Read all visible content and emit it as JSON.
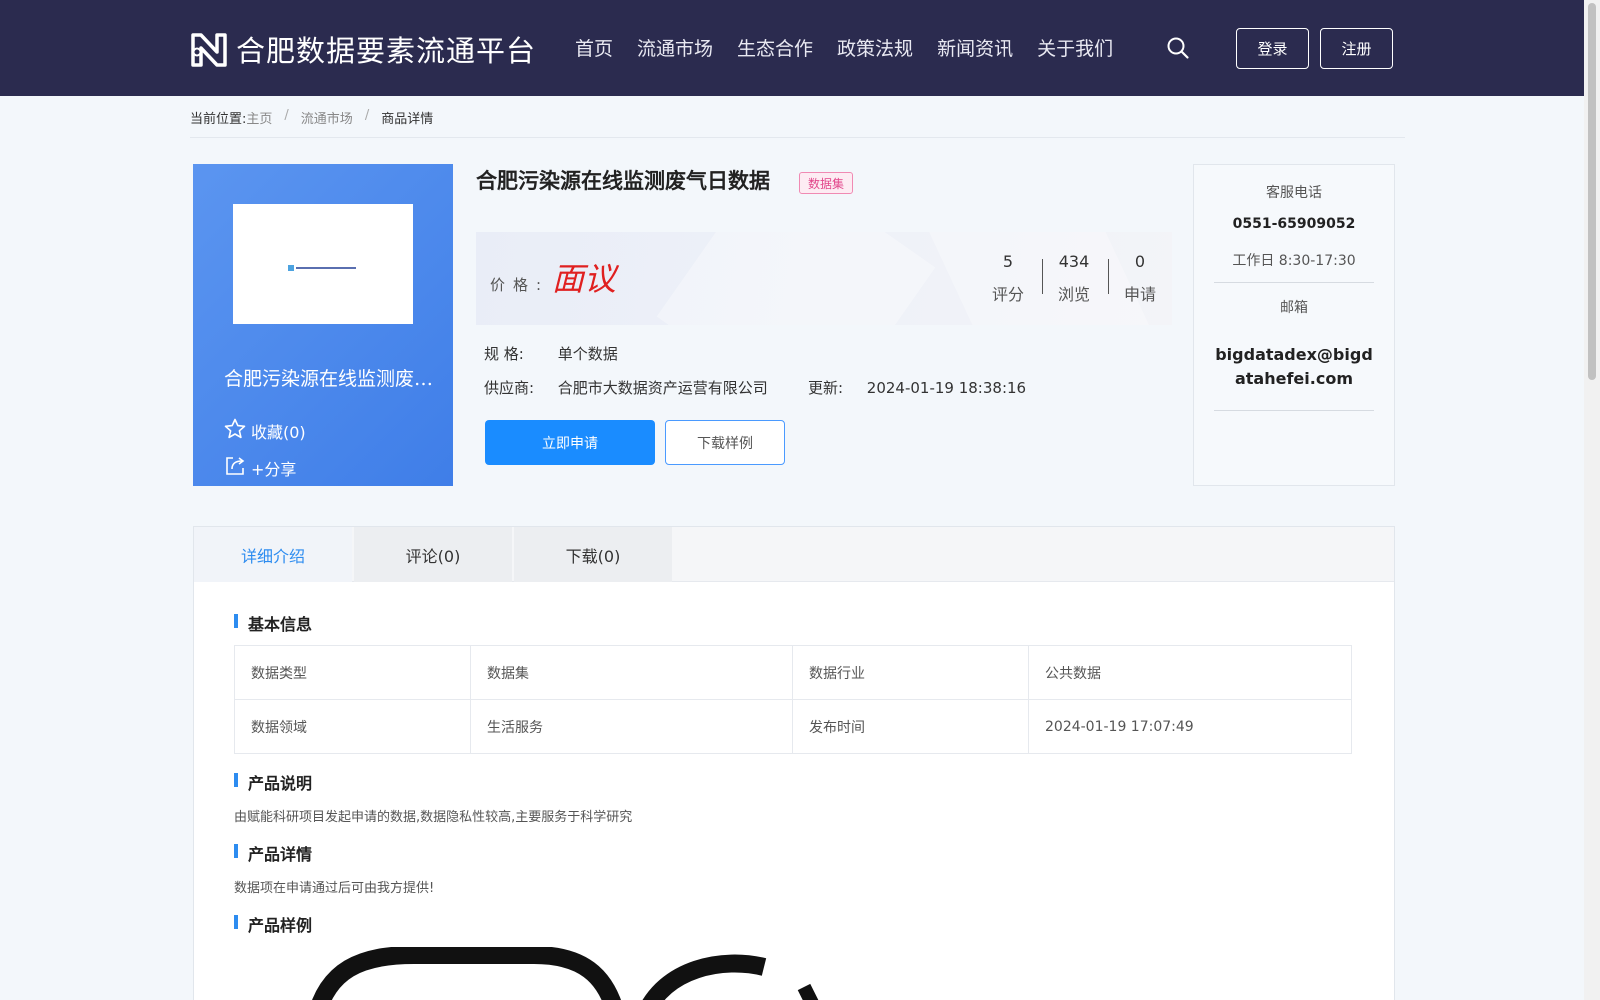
{
  "header": {
    "site_title": "合肥数据要素流通平台",
    "nav": [
      "首页",
      "流通市场",
      "生态合作",
      "政策法规",
      "新闻资讯",
      "关于我们"
    ],
    "login_label": "登录",
    "register_label": "注册",
    "bg_color": "#2b2b4f"
  },
  "breadcrumb": {
    "label": "当前位置:",
    "items": [
      "主页",
      "流通市场",
      "商品详情"
    ]
  },
  "card": {
    "title": "合肥污染源在线监测废气日数据",
    "favorite_label": "收藏(0)",
    "share_label": "+分享"
  },
  "product": {
    "title": "合肥污染源在线监测废气日数据",
    "tag": "数据集",
    "price_label": "价格:",
    "price_value": "面议",
    "stats": [
      {
        "value": "5",
        "label": "评分"
      },
      {
        "value": "434",
        "label": "浏览"
      },
      {
        "value": "0",
        "label": "申请"
      }
    ],
    "spec_label": "规 格:",
    "spec_value": "单个数据",
    "supplier_label": "供应商:",
    "supplier_value": "合肥市大数据资产运营有限公司",
    "update_label": "更新:",
    "update_value": "2024-01-19 18:38:16",
    "apply_label": "立即申请",
    "download_sample_label": "下载样例",
    "primary_color": "#1a8cff"
  },
  "contact": {
    "phone_label": "客服电话",
    "phone": "0551-65909052",
    "hours": "工作日 8:30-17:30",
    "email_label": "邮箱",
    "email": "bigdatadex@bigdatahefei.com"
  },
  "tabs": [
    "详细介绍",
    "评论(0)",
    "下载(0)"
  ],
  "basic_info": {
    "title": "基本信息",
    "rows": [
      [
        "数据类型",
        "数据集",
        "数据行业",
        "公共数据"
      ],
      [
        "数据领域",
        "生活服务",
        "发布时间",
        "2024-01-19 17:07:49"
      ]
    ]
  },
  "product_desc": {
    "title": "产品说明",
    "text": "由赋能科研项目发起申请的数据,数据隐私性较高,主要服务于科学研究"
  },
  "product_detail": {
    "title": "产品详情",
    "text": "数据项在申请通过后可由我方提供!"
  },
  "product_sample": {
    "title": "产品样例"
  }
}
